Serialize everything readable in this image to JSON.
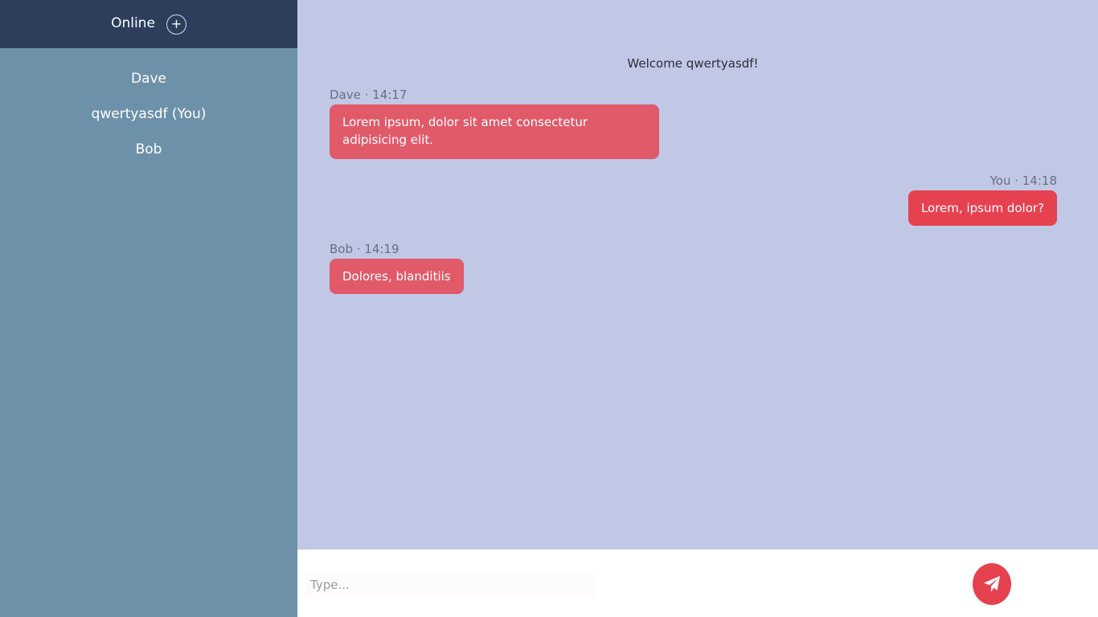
{
  "sidebar": {
    "title": "Online",
    "add_button_label": "+",
    "users": [
      "Dave",
      "qwertyasdf (You)",
      "Bob"
    ]
  },
  "chat": {
    "welcome": "Welcome qwertyasdf!",
    "messages": [
      {
        "meta": "Dave · 14:17",
        "text": "Lorem ipsum, dolor sit amet consectetur adipisicing elit."
      },
      {
        "meta": "You · 14:18",
        "text": "Lorem, ipsum dolor?"
      },
      {
        "meta": "Bob · 14:19",
        "text": "Dolores, blanditiis"
      }
    ]
  },
  "composer": {
    "placeholder": "Type...",
    "send_icon": "paper-plane-icon"
  },
  "colors": {
    "sidebar_header": "#2c3e5c",
    "sidebar_bg": "#6d91a8",
    "chat_bg": "#c0c8e6",
    "bubble_other": "#e05a6a",
    "bubble_self": "#e6414f",
    "send_button": "#e6414f"
  }
}
